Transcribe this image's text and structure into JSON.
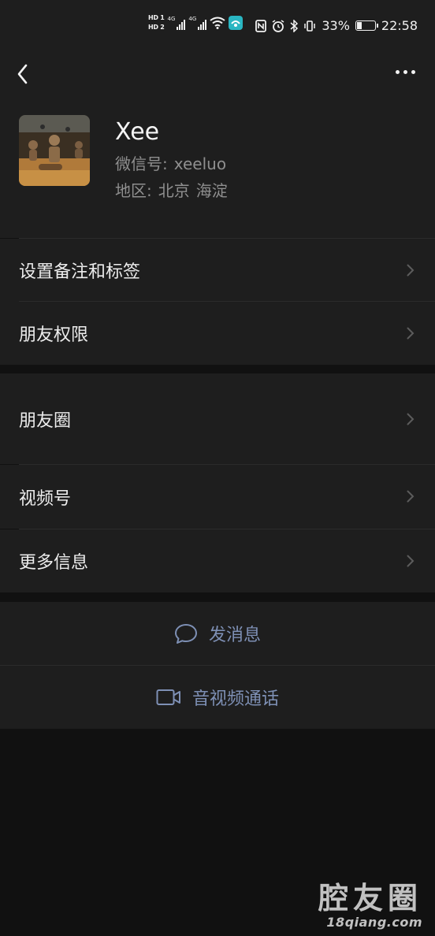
{
  "status_bar": {
    "hd1": "HD 1",
    "hd2": "HD 2",
    "net1": "4G",
    "net2": "4G",
    "battery_percent": "33%",
    "battery_level": 0.33,
    "time": "22:58"
  },
  "header": {
    "back_icon": "chevron-left-icon",
    "more_icon": "more-horizontal-icon"
  },
  "profile": {
    "name": "Xee",
    "wechat_id_label": "微信号:",
    "wechat_id": "xeeluo",
    "region_label": "地区:",
    "region_city": "北京",
    "region_district": "海淀"
  },
  "menu": {
    "remark_tags": "设置备注和标签",
    "friend_permissions": "朋友权限",
    "moments": "朋友圈",
    "channels": "视频号",
    "more_info": "更多信息"
  },
  "actions": {
    "send_message": "发消息",
    "video_call": "音视频通话",
    "accent_color": "#7e90b5"
  },
  "watermark": {
    "title": "腔友圈",
    "site": "18qiang.com"
  }
}
